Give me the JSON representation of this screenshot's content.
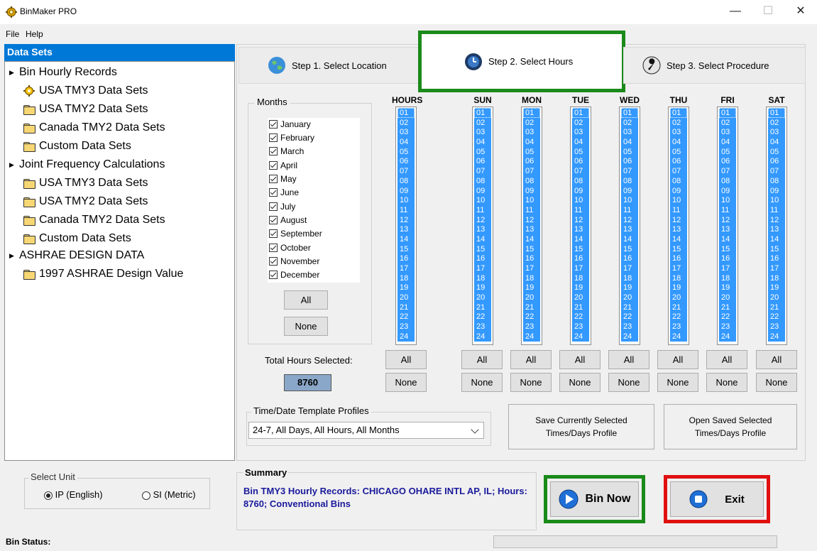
{
  "window": {
    "title": "BinMaker PRO",
    "minimize": "—",
    "maximize": "☐",
    "close": "✕"
  },
  "menu": [
    "File",
    "Help"
  ],
  "datasets": {
    "header": "Data Sets",
    "tree": [
      {
        "label": "Bin Hourly Records",
        "kind": "group"
      },
      {
        "label": "USA TMY3 Data Sets",
        "kind": "gear"
      },
      {
        "label": "USA TMY2 Data Sets",
        "kind": "folder"
      },
      {
        "label": "Canada TMY2 Data Sets",
        "kind": "folder"
      },
      {
        "label": "Custom Data Sets",
        "kind": "folder"
      },
      {
        "label": "Joint Frequency Calculations",
        "kind": "group"
      },
      {
        "label": "USA TMY3 Data Sets",
        "kind": "folder"
      },
      {
        "label": "USA TMY2 Data Sets",
        "kind": "folder"
      },
      {
        "label": "Canada TMY2 Data Sets",
        "kind": "folder"
      },
      {
        "label": "Custom Data Sets",
        "kind": "folder"
      },
      {
        "label": "ASHRAE DESIGN DATA",
        "kind": "group"
      },
      {
        "label": "1997 ASHRAE Design Value",
        "kind": "folder"
      }
    ]
  },
  "unit": {
    "label": "Select Unit",
    "ip": "IP (English)",
    "si": "SI (Metric)",
    "selected": "ip"
  },
  "tabs": {
    "step1": "Step 1.  Select Location",
    "step2": "Step 2.  Select Hours",
    "step3": "Step 3.  Select Procedure",
    "active": "step2"
  },
  "months": {
    "label": "Months",
    "items": [
      "January",
      "February",
      "March",
      "April",
      "May",
      "June",
      "July",
      "August",
      "September",
      "October",
      "November",
      "December"
    ],
    "all_label": "All",
    "none_label": "None"
  },
  "hours": {
    "columns": [
      "HOURS",
      "SUN",
      "MON",
      "TUE",
      "WED",
      "THU",
      "FRI",
      "SAT"
    ],
    "values": [
      "01",
      "02",
      "03",
      "04",
      "05",
      "06",
      "07",
      "08",
      "09",
      "10",
      "11",
      "12",
      "13",
      "14",
      "15",
      "16",
      "17",
      "18",
      "19",
      "20",
      "21",
      "22",
      "23",
      "24"
    ],
    "all_label": "All",
    "none_label": "None"
  },
  "total": {
    "label": "Total Hours Selected:",
    "value": "8760"
  },
  "template": {
    "label": "Time/Date Template Profiles",
    "selected": "24-7,  All Days, All Hours, All Months"
  },
  "buttons": {
    "save_profile": "Save Currently Selected Times/Days Profile",
    "open_profile": "Open Saved Selected Times/Days Profile",
    "bin_now": "Bin Now",
    "exit": "Exit"
  },
  "summary": {
    "title": "Summary",
    "text": "Bin TMY3 Hourly Records: CHICAGO OHARE INTL AP, IL; Hours: 8760; Conventional Bins"
  },
  "status": {
    "label": "Bin Status:"
  }
}
